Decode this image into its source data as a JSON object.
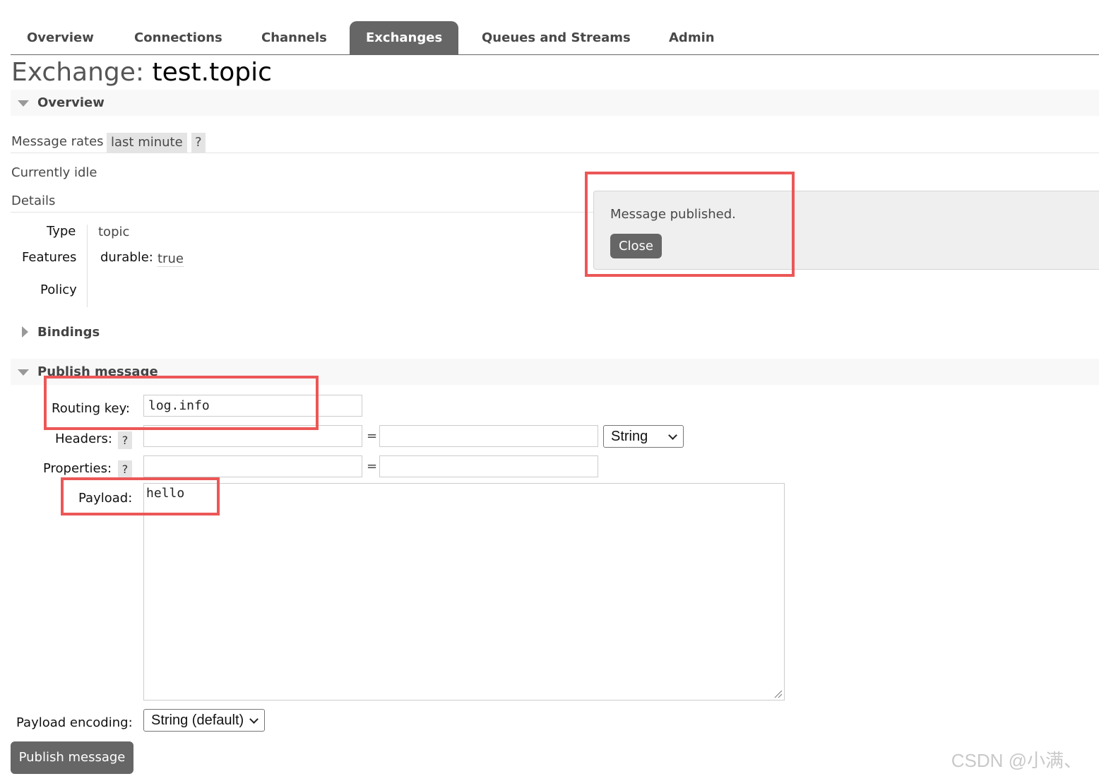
{
  "tabs": [
    {
      "label": "Overview",
      "active": false
    },
    {
      "label": "Connections",
      "active": false
    },
    {
      "label": "Channels",
      "active": false
    },
    {
      "label": "Exchanges",
      "active": true
    },
    {
      "label": "Queues and Streams",
      "active": false
    },
    {
      "label": "Admin",
      "active": false
    }
  ],
  "title": {
    "prefix": "Exchange:",
    "name": "test.topic"
  },
  "overview": {
    "heading": "Overview",
    "message_rates_label": "Message rates",
    "rates_period": "last minute",
    "help": "?",
    "idle_text": "Currently idle",
    "details_label": "Details",
    "details": {
      "type_label": "Type",
      "type_value": "topic",
      "features_label": "Features",
      "durable_key": "durable:",
      "durable_value": "true",
      "policy_label": "Policy"
    }
  },
  "bindings": {
    "heading": "Bindings"
  },
  "publish": {
    "heading": "Publish message",
    "routing_key_label": "Routing key:",
    "routing_key_value": "log.info",
    "headers_label": "Headers:",
    "headers_type": "String",
    "properties_label": "Properties:",
    "equals": "=",
    "help": "?",
    "payload_label": "Payload:",
    "payload_value": "hello",
    "encoding_label": "Payload encoding:",
    "encoding_value": "String (default)",
    "submit_label": "Publish message"
  },
  "notification": {
    "message": "Message published.",
    "close_label": "Close"
  },
  "highlight_color": "#ec5757",
  "watermark": "CSDN @小满、"
}
